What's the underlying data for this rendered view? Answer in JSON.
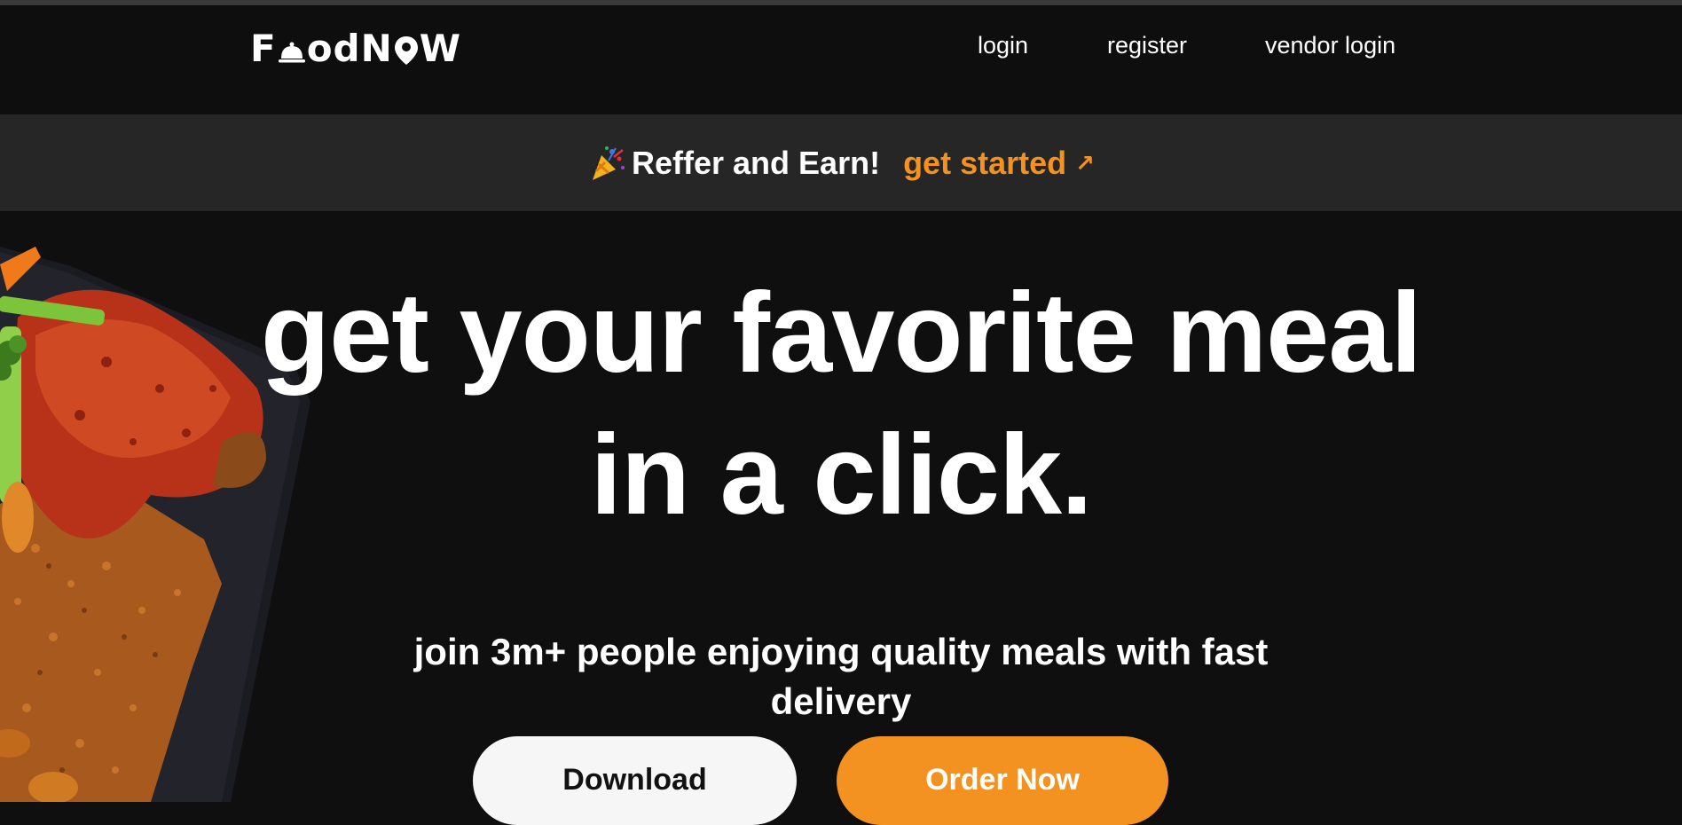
{
  "brand": {
    "logo_text_left": "f",
    "logo_text_right": "odN♥W",
    "logo_full": "FoodNOW"
  },
  "nav": {
    "links": [
      {
        "label": "login"
      },
      {
        "label": "register"
      },
      {
        "label": "vendor login"
      }
    ]
  },
  "promo": {
    "emoji_icon": "party-popper-icon",
    "text": "Reffer and Earn!",
    "link_label": "get started",
    "link_icon": "arrow-up-right-icon",
    "link_arrow": "↗"
  },
  "hero": {
    "headline_line1": "get your favorite meal",
    "headline_line2": "in a click.",
    "subtext_line1": "join 3m+ people enjoying quality meals with fast",
    "subtext_line2": "delivery",
    "image": "jollof-rice-chicken-plate-image"
  },
  "buttons": {
    "download": "Download",
    "order_now": "Order Now"
  },
  "colors": {
    "background": "#0f0f0f",
    "promo_bar": "#262626",
    "accent": "#f39220",
    "text": "#ffffff",
    "button_light": "#f6f6f6"
  }
}
